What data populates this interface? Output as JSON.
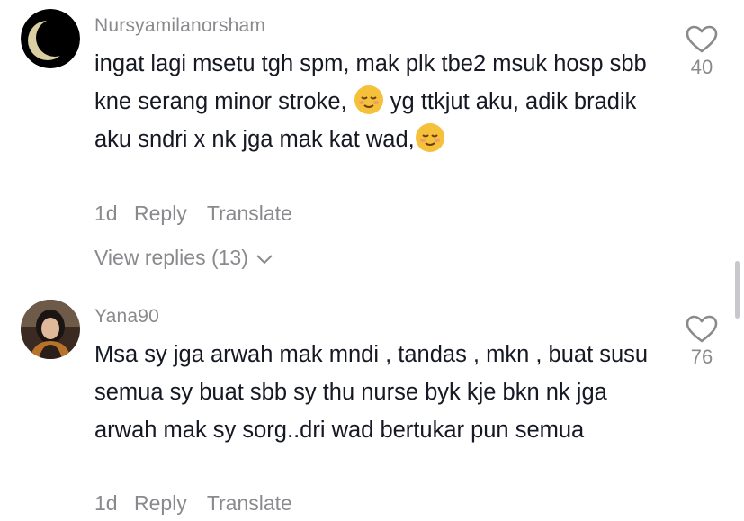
{
  "comments": [
    {
      "username": "Nursyamilanorsham",
      "text_parts": [
        "ingat lagi msetu tgh spm, mak plk tbe2 msuk hosp sbb kne serang minor stroke, ",
        " yg ttkjut aku, adik bradik aku sndri x nk jga mak kat wad,"
      ],
      "timestamp": "1d",
      "reply_label": "Reply",
      "translate_label": "Translate",
      "like_count": "40",
      "view_replies_label": "View replies (13)"
    },
    {
      "username": "Yana90",
      "text": "Msa sy jga arwah mak mndi , tandas , mkn , buat susu semua sy buat sbb sy thu nurse byk kje bkn nk jga arwah mak sy sorg..dri wad bertukar pun semua",
      "timestamp": "1d",
      "reply_label": "Reply",
      "translate_label": "Translate",
      "like_count": "76"
    }
  ],
  "icons": {
    "like": "heart-outline-icon",
    "expand": "chevron-down-icon",
    "emoji": "relieved-face-emoji"
  },
  "colors": {
    "text": "#161823",
    "muted": "#8a8a8e",
    "background": "#ffffff"
  }
}
